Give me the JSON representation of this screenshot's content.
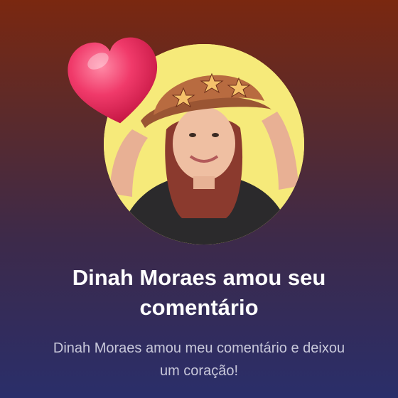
{
  "notification": {
    "title": "Dinah Moraes amou seu comentário",
    "subtitle": "Dinah Moraes amou meu comentário e deixou um coração!"
  },
  "avatar": {
    "background_color": "#f6ea7a"
  },
  "reaction": {
    "icon": "heart-icon",
    "color": "#e8245a"
  },
  "colors": {
    "background_top": "#7a2810",
    "background_bottom": "#2a2e6a"
  }
}
